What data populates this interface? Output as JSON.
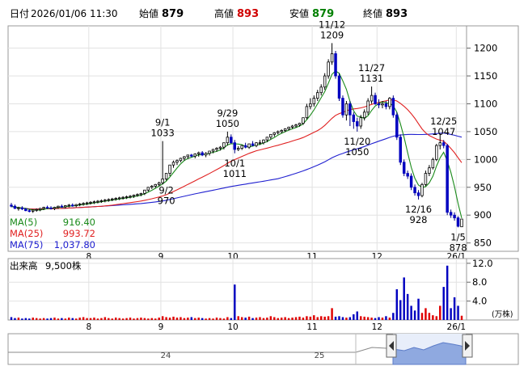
{
  "header": {
    "date_label": "日付",
    "datetime": "2026/01/06 11:30",
    "open_label": "始値",
    "open": "879",
    "high_label": "高値",
    "high": "893",
    "low_label": "安値",
    "low": "879",
    "close_label": "終値",
    "close": "893",
    "colors": {
      "high": "#d00000",
      "low": "#008000",
      "normal": "#000000"
    }
  },
  "ma_legend": [
    {
      "label": "MA(5)",
      "value": "916.40",
      "color": "#1a8a1a"
    },
    {
      "label": "MA(25)",
      "value": "993.72",
      "color": "#e02020"
    },
    {
      "label": "MA(75)",
      "value": "1,037.80",
      "color": "#2020d0"
    }
  ],
  "volume": {
    "label": "出来高",
    "value": "9,500株",
    "unit": "(万株)"
  },
  "x_ticks": [
    "8",
    "9",
    "10",
    "11",
    "12",
    "26/1"
  ],
  "navigator": {
    "ticks": [
      "24",
      "25"
    ]
  },
  "chart_data": [
    {
      "type": "candlestick",
      "x": [
        "7/1",
        "7/2",
        "7/3",
        "7/4",
        "7/7",
        "7/8",
        "7/9",
        "7/10",
        "7/11",
        "7/14",
        "7/15",
        "7/16",
        "7/17",
        "7/18",
        "7/22",
        "7/23",
        "7/24",
        "7/25",
        "7/28",
        "7/29",
        "7/30",
        "7/31",
        "8/1",
        "8/4",
        "8/5",
        "8/6",
        "8/7",
        "8/8",
        "8/12",
        "8/13",
        "8/14",
        "8/15",
        "8/18",
        "8/19",
        "8/20",
        "8/21",
        "8/22",
        "8/25",
        "8/26",
        "8/27",
        "8/28",
        "8/29",
        "9/1",
        "9/2",
        "9/3",
        "9/4",
        "9/5",
        "9/8",
        "9/9",
        "9/10",
        "9/11",
        "9/12",
        "9/16",
        "9/17",
        "9/18",
        "9/19",
        "9/22",
        "9/24",
        "9/25",
        "9/26",
        "9/29",
        "9/30",
        "10/1",
        "10/2",
        "10/3",
        "10/6",
        "10/7",
        "10/8",
        "10/9",
        "10/10",
        "10/14",
        "10/15",
        "10/16",
        "10/17",
        "10/20",
        "10/21",
        "10/22",
        "10/23",
        "10/24",
        "10/27",
        "10/28",
        "10/29",
        "10/30",
        "10/31",
        "11/4",
        "11/5",
        "11/6",
        "11/7",
        "11/10",
        "11/11",
        "11/12",
        "11/13",
        "11/14",
        "11/17",
        "11/18",
        "11/19",
        "11/20",
        "11/21",
        "11/25",
        "11/26",
        "11/27",
        "11/28",
        "12/1",
        "12/2",
        "12/3",
        "12/4",
        "12/5",
        "12/8",
        "12/9",
        "12/10",
        "12/11",
        "12/12",
        "12/15",
        "12/16",
        "12/17",
        "12/18",
        "12/19",
        "12/22",
        "12/23",
        "12/24",
        "12/25",
        "12/26",
        "12/29",
        "12/30",
        "1/5",
        "1/6"
      ],
      "open": [
        918,
        916,
        912,
        913,
        911,
        908,
        907,
        909,
        910,
        912,
        914,
        913,
        912,
        914,
        916,
        915,
        917,
        918,
        917,
        919,
        920,
        921,
        922,
        923,
        924,
        925,
        926,
        927,
        928,
        929,
        930,
        931,
        932,
        933,
        934,
        936,
        937,
        939,
        945,
        950,
        952,
        955,
        958,
        965,
        975,
        990,
        995,
        998,
        1002,
        1005,
        1008,
        1006,
        1010,
        1012,
        1008,
        1011,
        1015,
        1018,
        1020,
        1022,
        1030,
        1040,
        1030,
        1018,
        1020,
        1025,
        1022,
        1028,
        1025,
        1030,
        1030,
        1035,
        1040,
        1045,
        1048,
        1050,
        1052,
        1055,
        1058,
        1060,
        1062,
        1065,
        1075,
        1095,
        1100,
        1110,
        1120,
        1130,
        1150,
        1175,
        1190,
        1150,
        1110,
        1080,
        1100,
        1080,
        1068,
        1060,
        1075,
        1085,
        1105,
        1115,
        1100,
        1098,
        1100,
        1095,
        1110,
        1080,
        1040,
        995,
        975,
        970,
        950,
        940,
        935,
        955,
        975,
        985,
        1000,
        1025,
        1030,
        1025,
        905,
        900,
        895,
        879
      ],
      "high": [
        922,
        919,
        915,
        916,
        913,
        911,
        910,
        912,
        913,
        915,
        917,
        916,
        915,
        917,
        919,
        918,
        920,
        921,
        920,
        922,
        923,
        924,
        925,
        926,
        927,
        928,
        929,
        930,
        931,
        932,
        933,
        934,
        935,
        936,
        937,
        939,
        940,
        942,
        950,
        954,
        956,
        960,
        1033,
        975,
        990,
        998,
        1000,
        1003,
        1006,
        1008,
        1010,
        1011,
        1014,
        1015,
        1013,
        1015,
        1019,
        1022,
        1024,
        1028,
        1050,
        1045,
        1035,
        1024,
        1026,
        1030,
        1028,
        1033,
        1031,
        1035,
        1036,
        1040,
        1045,
        1049,
        1052,
        1054,
        1056,
        1059,
        1062,
        1064,
        1066,
        1070,
        1100,
        1110,
        1115,
        1125,
        1135,
        1155,
        1180,
        1209,
        1195,
        1155,
        1115,
        1105,
        1105,
        1085,
        1075,
        1080,
        1090,
        1110,
        1131,
        1120,
        1108,
        1105,
        1105,
        1112,
        1115,
        1085,
        1045,
        1000,
        980,
        975,
        955,
        945,
        958,
        980,
        990,
        1003,
        1028,
        1047,
        1035,
        1028,
        910,
        905,
        898,
        893
      ],
      "low": [
        914,
        911,
        908,
        909,
        907,
        905,
        904,
        906,
        907,
        909,
        911,
        910,
        909,
        911,
        913,
        912,
        914,
        915,
        914,
        916,
        917,
        918,
        919,
        920,
        921,
        922,
        923,
        924,
        925,
        926,
        927,
        928,
        929,
        930,
        931,
        933,
        934,
        936,
        942,
        947,
        949,
        952,
        955,
        962,
        970,
        985,
        990,
        995,
        998,
        1001,
        1004,
        1002,
        1005,
        1006,
        1004,
        1007,
        1011,
        1014,
        1016,
        1018,
        1025,
        1028,
        1011,
        1015,
        1017,
        1020,
        1019,
        1024,
        1022,
        1026,
        1027,
        1031,
        1036,
        1041,
        1045,
        1047,
        1049,
        1052,
        1055,
        1057,
        1059,
        1062,
        1072,
        1090,
        1095,
        1105,
        1115,
        1125,
        1145,
        1170,
        1145,
        1105,
        1075,
        1070,
        1060,
        1055,
        1050,
        1055,
        1070,
        1080,
        1100,
        1098,
        1092,
        1092,
        1090,
        1090,
        1075,
        1035,
        990,
        970,
        965,
        945,
        935,
        928,
        932,
        952,
        970,
        982,
        997,
        1018,
        1020,
        900,
        895,
        890,
        878,
        879
      ],
      "close": [
        916,
        912,
        913,
        911,
        908,
        907,
        909,
        910,
        912,
        914,
        913,
        912,
        914,
        916,
        915,
        917,
        918,
        917,
        919,
        920,
        921,
        922,
        923,
        924,
        925,
        926,
        927,
        928,
        929,
        930,
        931,
        932,
        933,
        934,
        936,
        937,
        939,
        945,
        950,
        952,
        955,
        958,
        965,
        975,
        990,
        995,
        998,
        1002,
        1005,
        1008,
        1006,
        1010,
        1012,
        1008,
        1011,
        1015,
        1018,
        1020,
        1022,
        1030,
        1040,
        1030,
        1018,
        1020,
        1025,
        1022,
        1028,
        1025,
        1030,
        1030,
        1035,
        1040,
        1045,
        1048,
        1050,
        1052,
        1055,
        1058,
        1060,
        1062,
        1065,
        1075,
        1095,
        1100,
        1110,
        1120,
        1130,
        1150,
        1175,
        1190,
        1150,
        1110,
        1080,
        1100,
        1080,
        1068,
        1060,
        1075,
        1085,
        1105,
        1115,
        1100,
        1098,
        1100,
        1095,
        1110,
        1080,
        1040,
        995,
        975,
        970,
        950,
        940,
        935,
        955,
        975,
        985,
        1000,
        1025,
        1030,
        1025,
        905,
        900,
        895,
        880,
        893
      ],
      "annotations": [
        {
          "x": "9/1",
          "label": "9/1",
          "value": 1033,
          "position": "above"
        },
        {
          "x": "9/2",
          "label": "9/2",
          "value": 970,
          "position": "below"
        },
        {
          "x": "9/29",
          "label": "9/29",
          "value": 1050,
          "position": "above"
        },
        {
          "x": "10/1",
          "label": "10/1",
          "value": 1011,
          "position": "below"
        },
        {
          "x": "11/11",
          "label": "11/12",
          "value": 1209,
          "position": "above"
        },
        {
          "x": "11/27",
          "label": "11/27",
          "value": 1131,
          "position": "above"
        },
        {
          "x": "11/20",
          "label": "11/20",
          "value": 1050,
          "position": "below"
        },
        {
          "x": "12/25",
          "label": "12/25",
          "value": 1047,
          "position": "above"
        },
        {
          "x": "12/16",
          "label": "12/16",
          "value": 928,
          "position": "below"
        },
        {
          "x": "1/5",
          "label": "1/5",
          "value": 878,
          "position": "below"
        }
      ],
      "ylim": [
        835,
        1240
      ],
      "y_ticks": [
        850,
        900,
        950,
        1000,
        1050,
        1100,
        1150,
        1200
      ],
      "grid": true
    },
    {
      "type": "bar",
      "x_ref": "same as candlestick",
      "values": [
        0.6,
        0.4,
        0.5,
        0.3,
        0.4,
        0.3,
        0.5,
        0.4,
        0.3,
        0.4,
        0.3,
        0.4,
        0.5,
        0.3,
        0.4,
        0.3,
        0.5,
        0.4,
        0.3,
        0.5,
        0.6,
        0.4,
        0.4,
        0.5,
        0.3,
        0.4,
        0.6,
        0.4,
        0.3,
        0.5,
        0.4,
        0.3,
        0.4,
        0.5,
        0.3,
        0.4,
        0.5,
        0.4,
        0.3,
        0.4,
        0.3,
        0.5,
        0.8,
        0.6,
        0.5,
        0.7,
        0.5,
        0.6,
        0.4,
        0.5,
        0.6,
        0.4,
        0.5,
        0.4,
        0.3,
        0.4,
        0.3,
        0.5,
        0.4,
        0.3,
        0.6,
        0.4,
        7.5,
        0.8,
        0.6,
        0.5,
        0.7,
        0.4,
        0.5,
        0.6,
        0.4,
        0.5,
        0.8,
        0.6,
        0.4,
        0.5,
        0.6,
        0.4,
        0.5,
        0.6,
        0.7,
        0.5,
        0.8,
        0.7,
        1.0,
        0.6,
        0.8,
        0.7,
        0.8,
        2.5,
        0.7,
        0.8,
        0.6,
        0.5,
        0.6,
        1.2,
        1.8,
        0.8,
        0.7,
        0.6,
        0.5,
        0.4,
        0.6,
        0.5,
        0.8,
        0.5,
        1.5,
        6.5,
        4.2,
        9.0,
        5.5,
        3.0,
        2.0,
        4.5,
        1.5,
        2.5,
        1.5,
        1.0,
        0.8,
        3.0,
        7.0,
        11.5,
        2.5,
        4.8,
        3.0,
        0.9
      ],
      "up_color": "#e00000",
      "down_color": "#0000c0",
      "ylim": [
        0,
        13
      ],
      "y_ticks": [
        4.0,
        8.0,
        12.0
      ],
      "unit": "(万株)"
    }
  ]
}
